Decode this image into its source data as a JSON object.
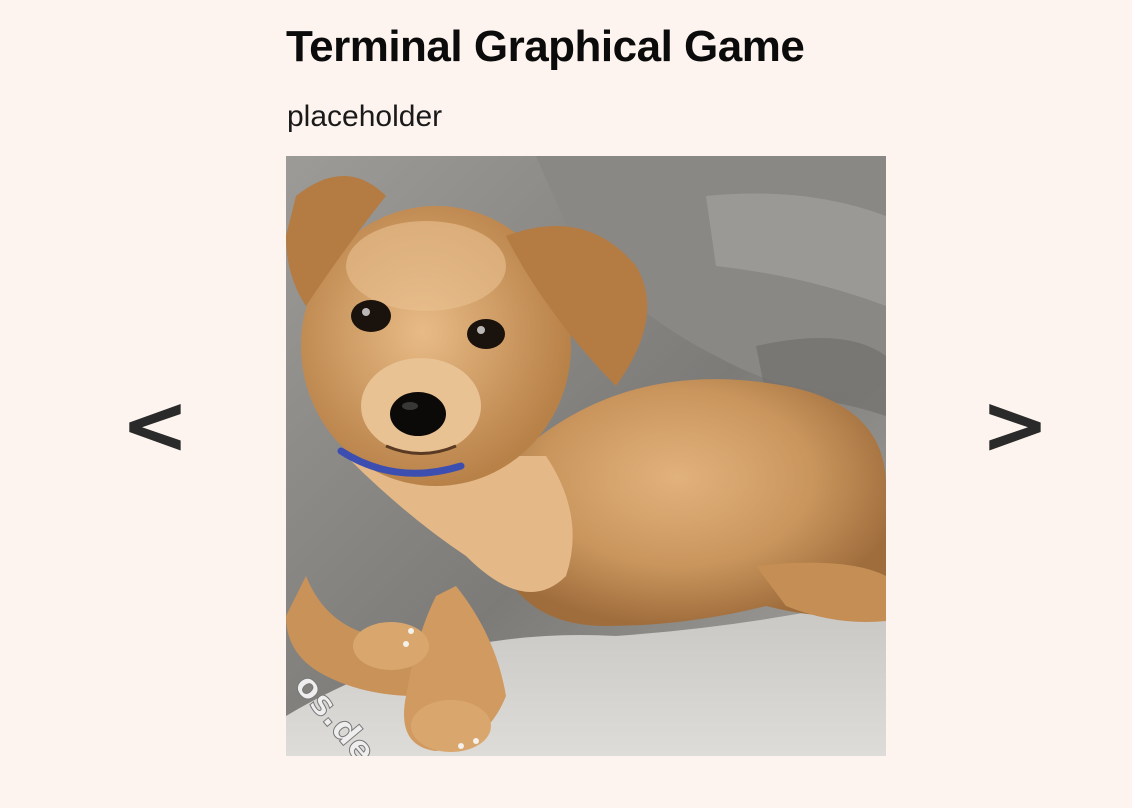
{
  "header": {
    "title": "Terminal Graphical Game",
    "subtitle": "placeholder"
  },
  "viewer": {
    "image": "puppy-photo",
    "watermark": "os.de",
    "prev_label": "<",
    "next_label": ">"
  },
  "colors": {
    "background": "#fdf4ef",
    "text": "#0b0b0b",
    "nav": "#2a2a2a"
  }
}
